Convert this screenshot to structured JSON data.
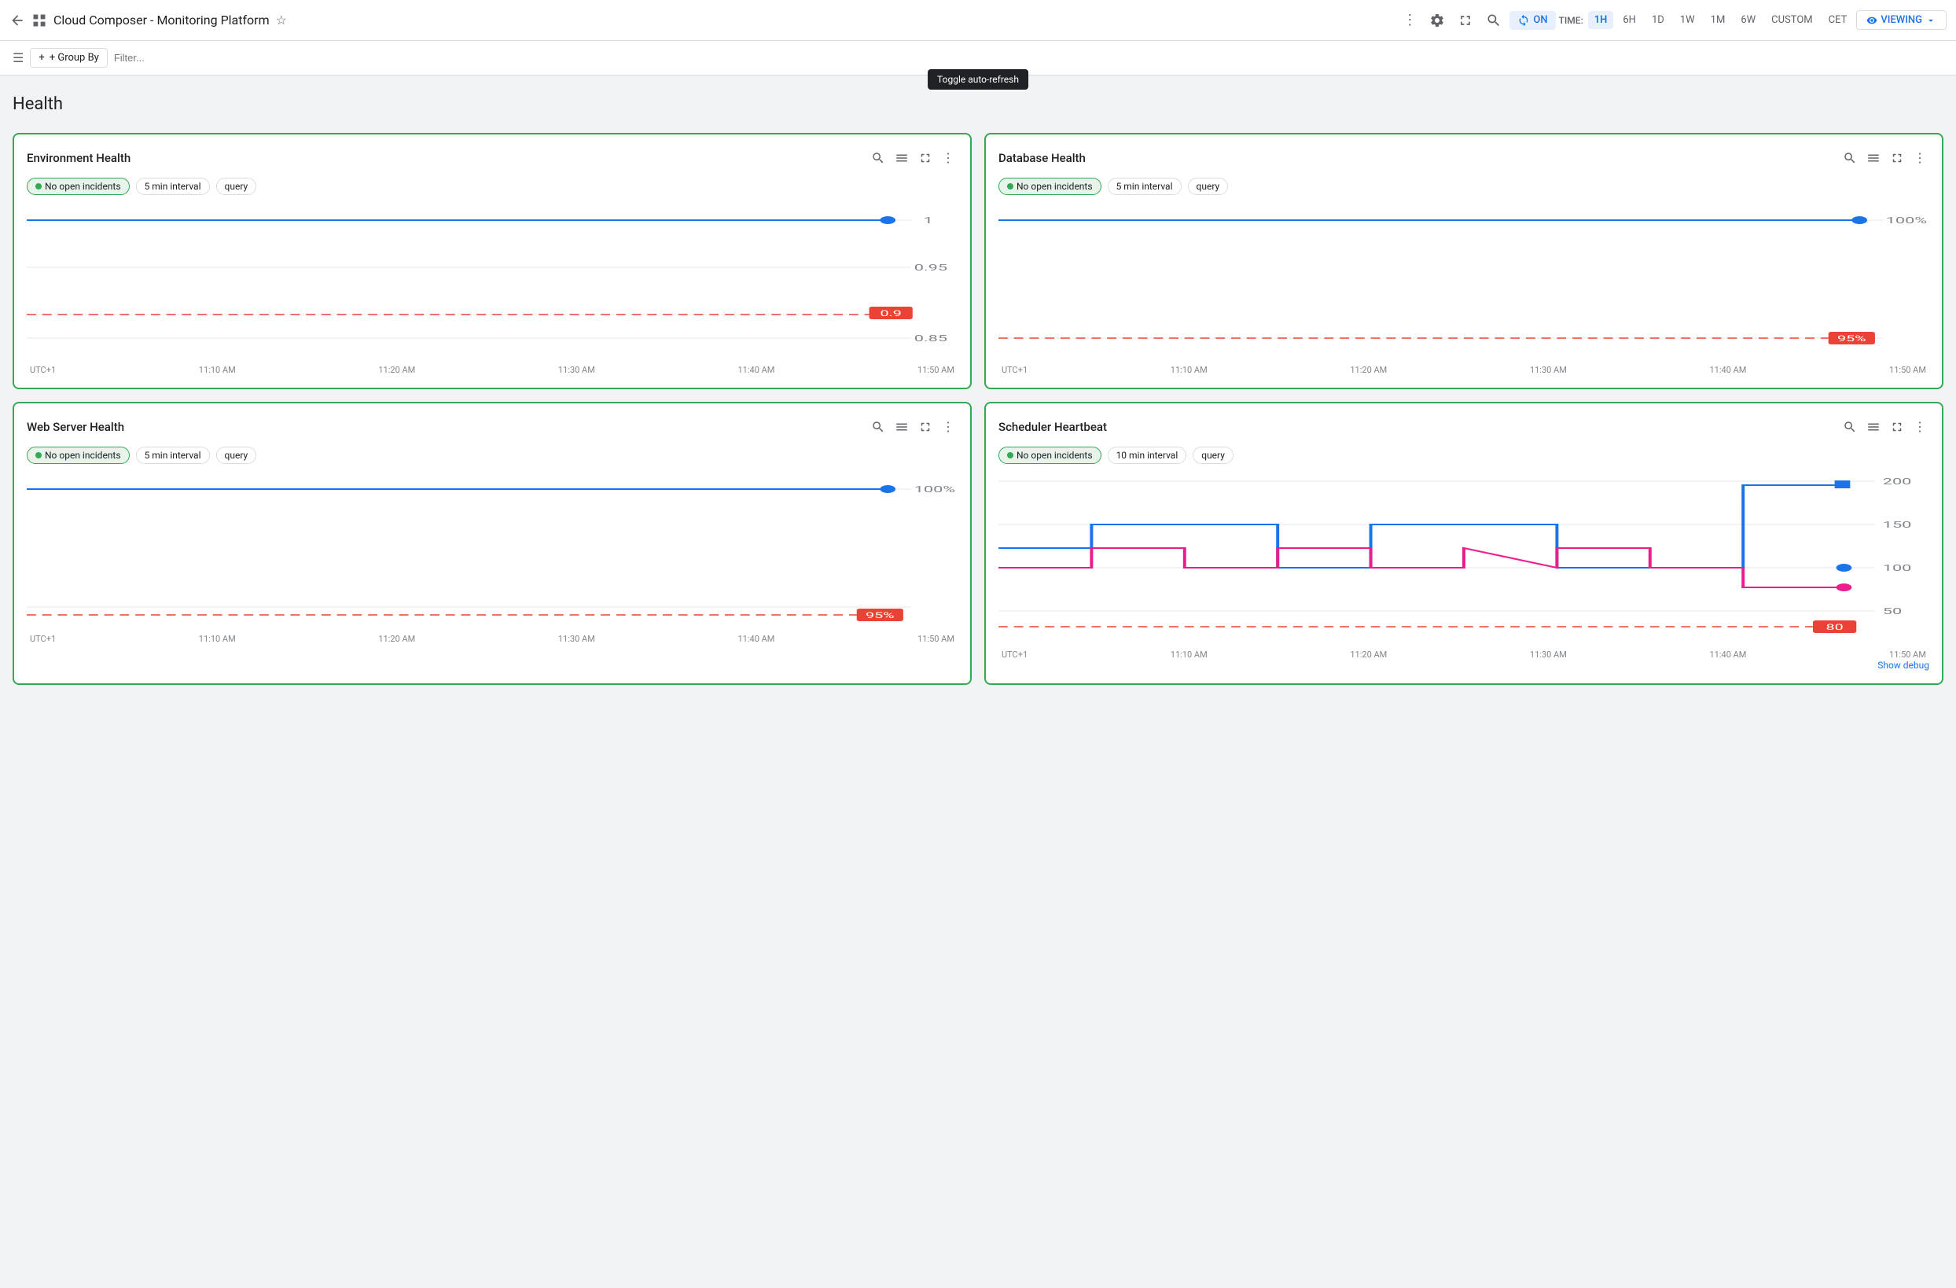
{
  "app": {
    "title": "Cloud Composer - Monitoring Platform",
    "back_icon": "←",
    "grid_icon": "⊞",
    "star_icon": "☆",
    "more_icon": "⋮",
    "settings_icon": "⚙",
    "expand_icon": "⤢",
    "search_icon": "🔍",
    "refresh_label": "ON",
    "time_label": "TIME:",
    "time_options": [
      "1H",
      "6H",
      "1D",
      "1W",
      "1M",
      "6W",
      "CUSTOM",
      "CET"
    ],
    "active_time": "1H",
    "viewing_label": "VIEWING",
    "tooltip_text": "Toggle auto-refresh"
  },
  "toolbar": {
    "group_by_label": "+ Group By",
    "filter_placeholder": "Filter...",
    "hamburger_icon": "☰",
    "plus_icon": "+"
  },
  "page": {
    "section_title": "Health"
  },
  "charts": [
    {
      "id": "env-health",
      "title": "Environment Health",
      "badge_label": "No open incidents",
      "interval_label": "5 min interval",
      "query_label": "query",
      "y_max": "1",
      "y_mid": "0.95",
      "y_low": "0.85",
      "threshold_value": "0.9",
      "x_labels": [
        "UTC+1",
        "11:10 AM",
        "11:20 AM",
        "11:30 AM",
        "11:40 AM",
        "11:50 AM"
      ],
      "line_color": "#1a73e8",
      "threshold_color": "#ea4335",
      "end_value": "1",
      "threshold_badge": "0.9"
    },
    {
      "id": "db-health",
      "title": "Database Health",
      "badge_label": "No open incidents",
      "interval_label": "5 min interval",
      "query_label": "query",
      "y_max": "100%",
      "threshold_value": "95%",
      "x_labels": [
        "UTC+1",
        "11:10 AM",
        "11:20 AM",
        "11:30 AM",
        "11:40 AM",
        "11:50 AM"
      ],
      "line_color": "#1a73e8",
      "threshold_color": "#ea4335",
      "end_value": "100%",
      "threshold_badge": "95%"
    },
    {
      "id": "web-health",
      "title": "Web Server Health",
      "badge_label": "No open incidents",
      "interval_label": "5 min interval",
      "query_label": "query",
      "y_max": "100%",
      "threshold_badge": "95%",
      "x_labels": [
        "UTC+1",
        "11:10 AM",
        "11:20 AM",
        "11:30 AM",
        "11:40 AM",
        "11:50 AM"
      ],
      "line_color": "#1a73e8",
      "threshold_color": "#ea4335",
      "end_value": "100%"
    },
    {
      "id": "scheduler",
      "title": "Scheduler Heartbeat",
      "badge_label": "No open incidents",
      "interval_label": "10 min interval",
      "query_label": "query",
      "y_labels": [
        "200",
        "150",
        "100",
        "50"
      ],
      "threshold_badge": "80",
      "x_labels": [
        "UTC+1",
        "11:10 AM",
        "11:20 AM",
        "11:30 AM",
        "11:40 AM",
        "11:50 AM"
      ],
      "line_color_1": "#1a73e8",
      "line_color_2": "#e91e8c",
      "threshold_color": "#ea4335",
      "show_debug": "Show debug"
    }
  ]
}
